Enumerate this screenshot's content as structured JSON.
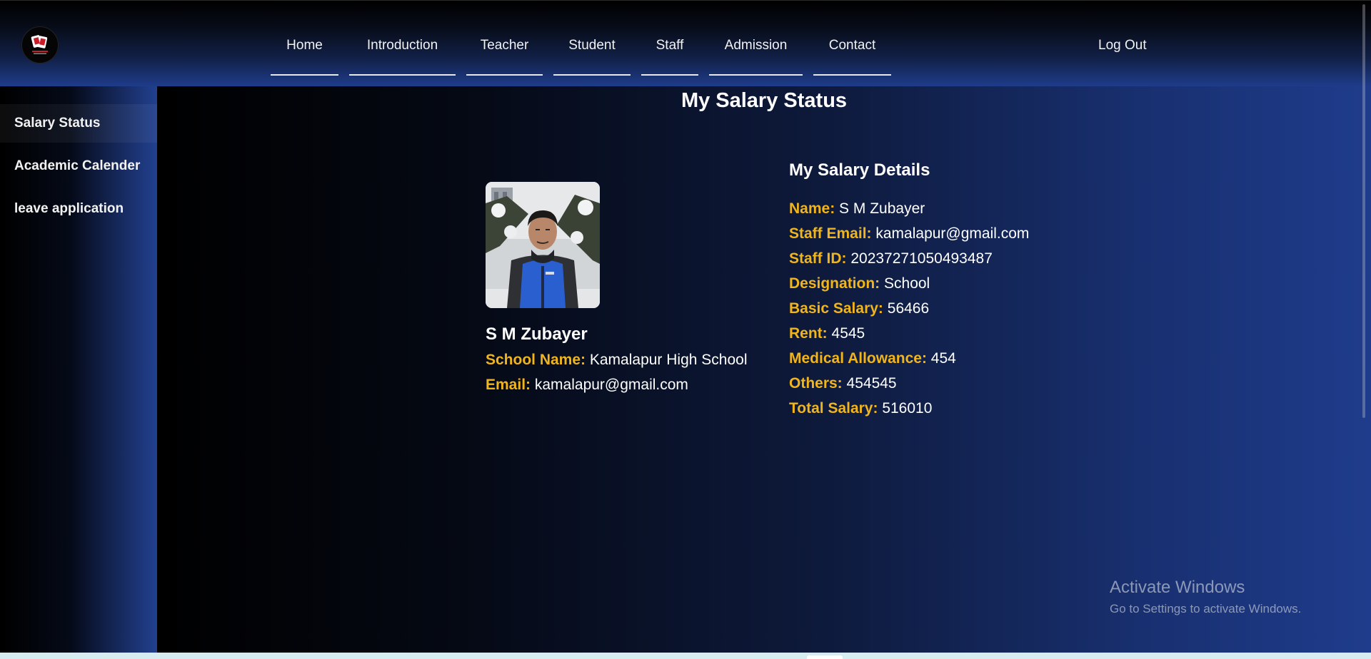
{
  "header": {
    "nav": [
      "Home",
      "Introduction",
      "Teacher",
      "Student",
      "Staff",
      "Admission",
      "Contact"
    ],
    "logout_label": "Log Out"
  },
  "sidebar": {
    "items": [
      {
        "label": "Salary Status"
      },
      {
        "label": "Academic Calender"
      },
      {
        "label": "leave application"
      }
    ]
  },
  "main": {
    "title": "My Salary Status",
    "profile": {
      "name": "S M Zubayer",
      "school_label": "School Name:",
      "school_value": "Kamalapur High School",
      "email_label": "Email:",
      "email_value": "kamalapur@gmail.com"
    },
    "details": {
      "title": "My Salary Details",
      "rows": [
        {
          "label": "Name:",
          "value": "S M Zubayer"
        },
        {
          "label": "Staff Email:",
          "value": "kamalapur@gmail.com"
        },
        {
          "label": "Staff ID:",
          "value": "20237271050493487"
        },
        {
          "label": "Designation:",
          "value": "School"
        },
        {
          "label": "Basic Salary:",
          "value": "56466"
        },
        {
          "label": "Rent:",
          "value": "4545"
        },
        {
          "label": "Medical Allowance:",
          "value": "454"
        },
        {
          "label": "Others:",
          "value": "454545"
        },
        {
          "label": "Total Salary:",
          "value": "516010"
        }
      ]
    }
  },
  "watermark": {
    "line1": "Activate Windows",
    "line2": "Go to Settings to activate Windows."
  },
  "colors": {
    "label_accent": "#f0b41c",
    "header_bottom": "#1f3d8c",
    "text": "#ffffff"
  }
}
